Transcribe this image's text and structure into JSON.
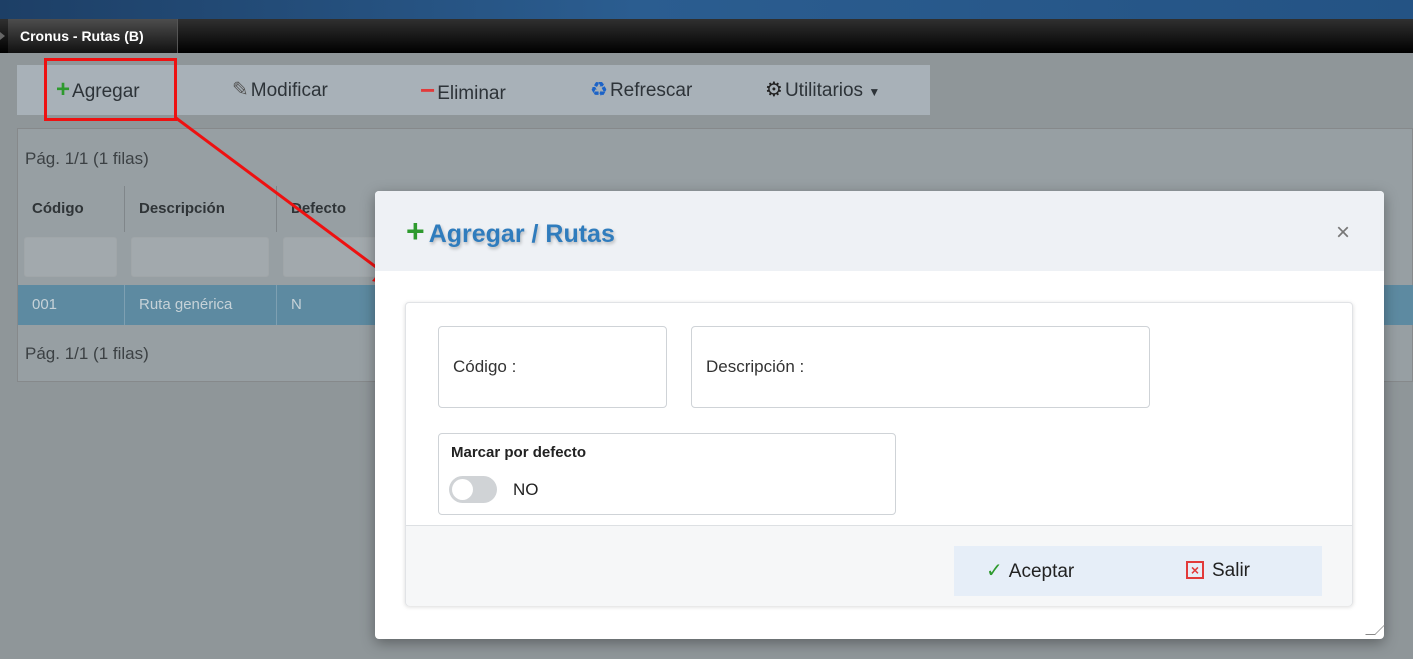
{
  "window": {
    "title": "Cronus - Rutas (B)"
  },
  "toolbar": {
    "add_label": "Agregar",
    "modify_label": "Modificar",
    "delete_label": "Eliminar",
    "refresh_label": "Refrescar",
    "utilities_label": "Utilitarios"
  },
  "grid": {
    "pager_top": "Pág. 1/1 (1 filas)",
    "pager_bottom": "Pág. 1/1 (1 filas)",
    "columns": [
      "Código",
      "Descripción",
      "Defecto"
    ],
    "rows": [
      {
        "codigo": "001",
        "descripcion": "Ruta genérica",
        "defecto": "N"
      }
    ]
  },
  "dialog": {
    "title": "Agregar / Rutas",
    "close_symbol": "×",
    "codigo_label": "Código :",
    "descripcion_label": "Descripción :",
    "default_label": "Marcar por defecto",
    "default_state": "NO",
    "accept_label": "Aceptar",
    "exit_label": "Salir"
  },
  "colors": {
    "accent_blue": "#2f7cbd",
    "add_green": "#2e9a2e",
    "delete_red": "#e23a3a",
    "selected_row": "#5d8aa1",
    "annotation_red": "#ee1111"
  }
}
